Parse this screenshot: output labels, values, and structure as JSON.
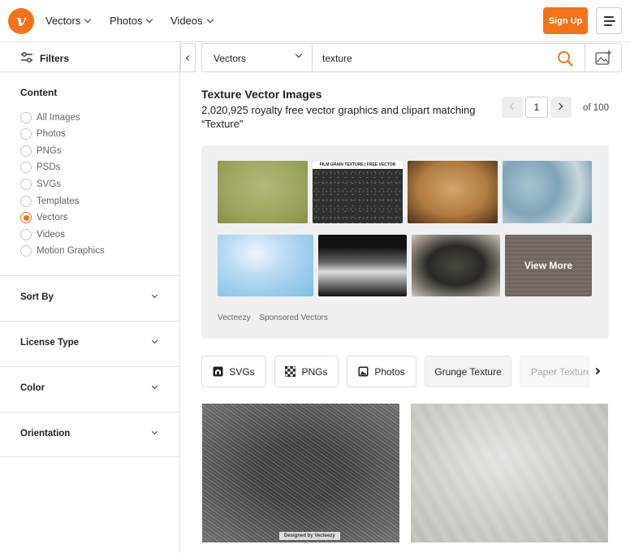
{
  "nav": {
    "brand_letter": "v",
    "items": [
      {
        "label": "Vectors"
      },
      {
        "label": "Photos"
      },
      {
        "label": "Videos"
      }
    ],
    "signup_label": "Sign Up"
  },
  "sidebar": {
    "filters_label": "Filters",
    "content_title": "Content",
    "content_options": [
      {
        "label": "All Images",
        "selected": false
      },
      {
        "label": "Photos",
        "selected": false
      },
      {
        "label": "PNGs",
        "selected": false
      },
      {
        "label": "PSDs",
        "selected": false
      },
      {
        "label": "SVGs",
        "selected": false
      },
      {
        "label": "Templates",
        "selected": false
      },
      {
        "label": "Vectors",
        "selected": true
      },
      {
        "label": "Videos",
        "selected": false
      },
      {
        "label": "Motion Graphics",
        "selected": false
      }
    ],
    "sections": [
      {
        "label": "Sort By"
      },
      {
        "label": "License Type"
      },
      {
        "label": "Color"
      },
      {
        "label": "Orientation"
      }
    ]
  },
  "search": {
    "type_value": "Vectors",
    "query": "texture"
  },
  "results_header": {
    "title": "Texture Vector Images",
    "subtitle": "2,020,925 royalty free vector graphics and clipart matching “Texture”"
  },
  "pagination": {
    "current_page": "1",
    "of_label": "of 100"
  },
  "sponsored": {
    "thumb2_caption": "FILM GRAIN TEXTURE | FREE VECTOR",
    "view_more_label": "View More",
    "provider": "Vecteezy",
    "note": "Sponsored Vectors"
  },
  "chips": [
    {
      "label": "SVGs",
      "icon": "svg-file-icon"
    },
    {
      "label": "PNGs",
      "icon": "checkerboard-icon"
    },
    {
      "label": "Photos",
      "icon": "photo-icon"
    },
    {
      "label": "Grunge Texture",
      "icon": ""
    },
    {
      "label": "Paper Texture",
      "icon": ""
    }
  ],
  "results": {
    "watermark_1": "Designed by Vecteezy"
  },
  "colors": {
    "accent": "#f2731b"
  }
}
